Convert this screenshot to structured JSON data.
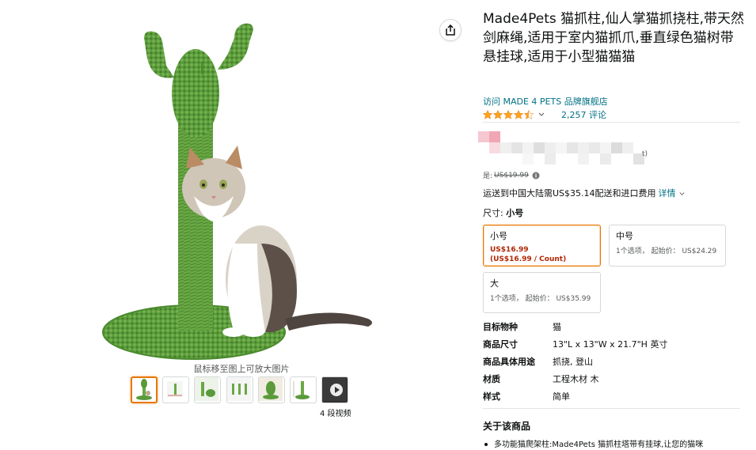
{
  "product": {
    "title": "Made4Pets 猫抓柱,仙人掌猫抓挠柱,带天然剑麻绳,适用于室内猫抓爪,垂直绿色猫树带悬挂球,适用于小型猫猫猫",
    "store_link": "访问 MADE 4 PETS 品牌旗舰店",
    "rating": 4.5,
    "review_count": "2,257 评论"
  },
  "gallery": {
    "zoom_hint": "鼠标移至图上可放大图片",
    "video_count": "4 段视频",
    "thumbnails": [
      "thumb-1",
      "thumb-2",
      "thumb-3",
      "thumb-4",
      "thumb-5",
      "thumb-6",
      "thumb-video"
    ]
  },
  "pricing": {
    "list_price_label": "是:",
    "list_price": "US$19.99",
    "shipping_text": "运送到中国大陆需US$35.14配送和进口费用",
    "shipping_details": "详情",
    "blur_suffix": "t)"
  },
  "size": {
    "label": "尺寸:",
    "selected": "小号",
    "options": [
      {
        "name": "小号",
        "price": "US$16.99",
        "unit": "(US$16.99 / Count)"
      },
      {
        "name": "中号",
        "note": "1个选项，  起始价：  US$24.29"
      },
      {
        "name": "大",
        "note": "1个选项，  起始价：  US$35.99"
      }
    ]
  },
  "specs": [
    {
      "key": "目标物种",
      "value": "猫"
    },
    {
      "key": "商品尺寸",
      "value": "13\"L x 13\"W x 21.7\"H 英寸"
    },
    {
      "key": "商品具体用途",
      "value": "抓挠, 登山"
    },
    {
      "key": "材质",
      "value": "工程木材 木"
    },
    {
      "key": "样式",
      "value": "简单"
    }
  ],
  "about": {
    "title": "关于该商品",
    "bullet": "多功能猫爬架柱:Made4Pets 猫抓柱塔带有挂球,让您的猫咪"
  },
  "colors": {
    "link": "#007185",
    "star": "#ffa41c",
    "price_red": "#b12704",
    "selected_border": "#e77600",
    "cactus_green": "#5a9a3a"
  },
  "icons": {
    "share": "share-icon",
    "info": "info-icon",
    "chevron": "chevron-down-icon",
    "play": "play-icon"
  }
}
